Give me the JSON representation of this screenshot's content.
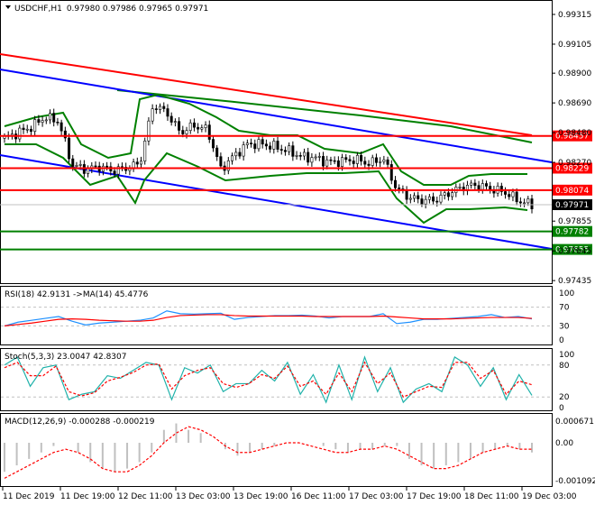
{
  "header": {
    "symbol": "USDCHF,H1",
    "ohlc": "0.97980 0.97986 0.97965 0.97971"
  },
  "colors": {
    "red": "#ff0000",
    "green": "#008000",
    "blue": "#0000ff",
    "rsi": "#1e90ff",
    "stoch": "#20b2aa",
    "hist": "#c0c0c0"
  },
  "price_axis": {
    "ticks": [
      "0.99315",
      "0.99105",
      "0.98900",
      "0.98690",
      "0.98480",
      "0.98270",
      "0.97855",
      "0.97645",
      "0.97435"
    ],
    "tick_values": [
      0.99315,
      0.99105,
      0.989,
      0.9869,
      0.9848,
      0.9827,
      0.97855,
      0.97645,
      0.97435
    ],
    "levels": [
      {
        "label": "0.98457",
        "value": 0.98457,
        "color": "#ff0000"
      },
      {
        "label": "0.98229",
        "value": 0.98229,
        "color": "#ff0000"
      },
      {
        "label": "0.98074",
        "value": 0.98074,
        "color": "#ff0000"
      },
      {
        "label": "0.97782",
        "value": 0.97782,
        "color": "#008000"
      },
      {
        "label": "0.97655",
        "value": 0.97655,
        "color": "#008000"
      }
    ],
    "current": {
      "label": "0.97971",
      "value": 0.97971
    }
  },
  "time_axis": [
    "11 Dec 2019",
    "11 Dec 19:00",
    "12 Dec 11:00",
    "13 Dec 03:00",
    "13 Dec 19:00",
    "16 Dec 11:00",
    "17 Dec 03:00",
    "17 Dec 19:00",
    "18 Dec 11:00",
    "19 Dec 03:00"
  ],
  "chart_data": [
    {
      "type": "candlestick",
      "title": "USDCHF,H1",
      "close": [
        0.9844,
        0.9848,
        0.9852,
        0.9859,
        0.9856,
        0.9825,
        0.9822,
        0.9824,
        0.9821,
        0.9823,
        0.9826,
        0.9868,
        0.9862,
        0.9848,
        0.9853,
        0.985,
        0.9822,
        0.9832,
        0.984,
        0.984,
        0.9838,
        0.9835,
        0.9831,
        0.983,
        0.9827,
        0.9828,
        0.9829,
        0.9826,
        0.983,
        0.9808,
        0.9802,
        0.98,
        0.9801,
        0.9806,
        0.981,
        0.9811,
        0.9808,
        0.9806,
        0.98,
        0.9797
      ]
    },
    {
      "type": "line",
      "title": "RSI(18) 42.9131  ->MA(14) 45.4776",
      "ylim": [
        0,
        100
      ],
      "ticks": [
        "100",
        "70",
        "30",
        "0"
      ],
      "tick_values": [
        100,
        70,
        30,
        0
      ],
      "rsi": [
        30,
        38,
        42,
        46,
        50,
        40,
        32,
        36,
        38,
        40,
        42,
        47,
        62,
        56,
        55,
        56,
        57,
        44,
        48,
        50,
        52,
        52,
        53,
        51,
        47,
        50,
        50,
        50,
        56,
        35,
        38,
        44,
        44,
        46,
        48,
        50,
        54,
        48,
        50,
        45
      ],
      "ma": [
        30,
        33,
        36,
        40,
        44,
        45,
        44,
        42,
        41,
        40,
        40,
        42,
        48,
        52,
        53,
        54,
        54,
        52,
        51,
        51,
        51,
        51,
        51,
        50,
        50,
        50,
        50,
        50,
        51,
        49,
        47,
        45,
        45,
        45,
        46,
        47,
        48,
        48,
        48,
        46
      ]
    },
    {
      "type": "line",
      "title": "Stoch(5,3,3) 23.0047 42.8307",
      "ylim": [
        0,
        100
      ],
      "ticks": [
        "100",
        "80",
        "20",
        "0"
      ],
      "tick_values": [
        100,
        80,
        20,
        0
      ],
      "main": [
        80,
        95,
        40,
        75,
        80,
        15,
        25,
        30,
        60,
        55,
        70,
        85,
        80,
        15,
        75,
        65,
        80,
        30,
        45,
        45,
        70,
        50,
        85,
        25,
        62,
        10,
        80,
        15,
        95,
        30,
        75,
        10,
        35,
        45,
        30,
        95,
        80,
        40,
        75,
        15,
        62,
        23
      ],
      "signal": [
        75,
        85,
        60,
        60,
        78,
        30,
        22,
        28,
        50,
        57,
        66,
        80,
        82,
        35,
        60,
        70,
        75,
        45,
        38,
        45,
        62,
        55,
        78,
        40,
        50,
        25,
        65,
        30,
        85,
        45,
        65,
        20,
        30,
        40,
        38,
        85,
        85,
        55,
        70,
        25,
        50,
        43
      ]
    },
    {
      "type": "bar+line",
      "title": "MACD(12,26,9) -0.000288 -0.000219",
      "ylim": [
        -0.001092,
        0.000671
      ],
      "ticks": [
        "0.000671",
        "0.00",
        "-0.001092"
      ],
      "tick_values": [
        0.000671,
        0,
        -0.001092
      ],
      "hist": [
        -9,
        -7,
        -5,
        -3,
        -1,
        0,
        -3,
        -6,
        -8,
        -9,
        -8,
        -6,
        -3,
        4,
        6,
        4,
        3,
        0,
        -2,
        -4,
        -3,
        -2,
        -1,
        0,
        0,
        0,
        -1,
        -2,
        -3,
        -2,
        -2,
        -1,
        -1,
        -5,
        -7,
        -8,
        -7,
        -6,
        -5,
        -3,
        -2,
        -1,
        -2,
        -3
      ],
      "signal": [
        -11,
        -9,
        -7,
        -5,
        -3,
        -2,
        -3,
        -5,
        -8,
        -9,
        -9,
        -7,
        -4,
        0,
        3,
        5,
        4,
        2,
        -1,
        -3,
        -3,
        -2,
        -1,
        0,
        0,
        -1,
        -2,
        -3,
        -3,
        -2,
        -2,
        -1,
        -2,
        -4,
        -6,
        -8,
        -8,
        -7,
        -5,
        -3,
        -2,
        -1,
        -2,
        -2
      ]
    }
  ]
}
